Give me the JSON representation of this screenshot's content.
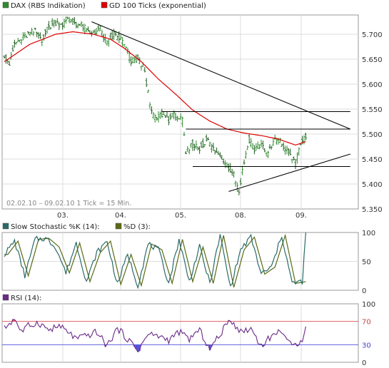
{
  "chart_data": [
    {
      "type": "line",
      "subtype": "ohlc-bars",
      "instrument": "DAX (RBS Indikation)",
      "series": [
        {
          "name": "DAX (RBS Indikation)",
          "color": "#2f8a2f"
        },
        {
          "name": "GD 100 Ticks (exponential)",
          "color": "#dd0000"
        }
      ],
      "info_text": "02.02.10 – 09.02.10   1 Tick = 15 Min.",
      "x_ticks": [
        "03.",
        "04.",
        "05.",
        "08.",
        "09."
      ],
      "y_ticks": [
        "5.700",
        "5.650",
        "5.600",
        "5.550",
        "5.500",
        "5.450",
        "5.400",
        "5.350"
      ],
      "ylim": [
        5350,
        5735
      ],
      "grid": true,
      "price_anchors": [
        [
          0,
          5660
        ],
        [
          3,
          5640
        ],
        [
          6,
          5680
        ],
        [
          10,
          5690
        ],
        [
          14,
          5700
        ],
        [
          18,
          5705
        ],
        [
          22,
          5690
        ],
        [
          26,
          5715
        ],
        [
          30,
          5725
        ],
        [
          34,
          5720
        ],
        [
          38,
          5730
        ],
        [
          42,
          5722
        ],
        [
          46,
          5715
        ],
        [
          50,
          5700
        ],
        [
          52,
          5705
        ],
        [
          56,
          5710
        ],
        [
          60,
          5680
        ],
        [
          64,
          5700
        ],
        [
          68,
          5690
        ],
        [
          72,
          5665
        ],
        [
          74,
          5645
        ],
        [
          78,
          5650
        ],
        [
          82,
          5630
        ],
        [
          85,
          5555
        ],
        [
          88,
          5530
        ],
        [
          92,
          5540
        ],
        [
          96,
          5530
        ],
        [
          100,
          5540
        ],
        [
          104,
          5525
        ],
        [
          106,
          5460
        ],
        [
          110,
          5480
        ],
        [
          114,
          5470
        ],
        [
          118,
          5490
        ],
        [
          122,
          5470
        ],
        [
          126,
          5455
        ],
        [
          130,
          5440
        ],
        [
          134,
          5420
        ],
        [
          137,
          5385
        ],
        [
          140,
          5445
        ],
        [
          143,
          5490
        ],
        [
          146,
          5470
        ],
        [
          150,
          5480
        ],
        [
          154,
          5460
        ],
        [
          158,
          5490
        ],
        [
          161,
          5485
        ],
        [
          164,
          5470
        ],
        [
          167,
          5460
        ],
        [
          170,
          5440
        ],
        [
          173,
          5480
        ],
        [
          176,
          5495
        ]
      ],
      "ema_anchors": [
        [
          0,
          5645
        ],
        [
          15,
          5680
        ],
        [
          30,
          5700
        ],
        [
          40,
          5705
        ],
        [
          52,
          5700
        ],
        [
          62,
          5690
        ],
        [
          70,
          5672
        ],
        [
          80,
          5645
        ],
        [
          90,
          5610
        ],
        [
          100,
          5580
        ],
        [
          110,
          5548
        ],
        [
          120,
          5526
        ],
        [
          130,
          5510
        ],
        [
          140,
          5502
        ],
        [
          150,
          5497
        ],
        [
          160,
          5490
        ],
        [
          170,
          5478
        ],
        [
          176,
          5485
        ]
      ],
      "trendlines": [
        {
          "name": "resistance",
          "from": [
            51,
            5725
          ],
          "to": [
            202,
            5510
          ]
        },
        {
          "name": "support",
          "from": [
            131,
            5385
          ],
          "to": [
            202,
            5460
          ]
        },
        {
          "name": "channel-top",
          "from": [
            92,
            5545
          ],
          "to": [
            202,
            5545
          ]
        },
        {
          "name": "range-top",
          "from": [
            106,
            5510
          ],
          "to": [
            202,
            5510
          ]
        },
        {
          "name": "range-bottom",
          "from": [
            110,
            5435
          ],
          "to": [
            202,
            5435
          ]
        }
      ],
      "n_ticks": 202
    },
    {
      "type": "line",
      "series": [
        {
          "name": "Slow Stochastic %K (14):",
          "color": "#2a6a68"
        },
        {
          "name": "%D (3):",
          "color": "#5a6a14"
        }
      ],
      "y_ticks": [
        "100",
        "50",
        "0"
      ],
      "ylim": [
        0,
        100
      ],
      "stoch_anchors": [
        [
          0,
          62
        ],
        [
          6,
          85
        ],
        [
          12,
          25
        ],
        [
          18,
          88
        ],
        [
          24,
          90
        ],
        [
          30,
          75
        ],
        [
          36,
          30
        ],
        [
          42,
          82
        ],
        [
          48,
          15
        ],
        [
          54,
          65
        ],
        [
          60,
          85
        ],
        [
          66,
          10
        ],
        [
          72,
          62
        ],
        [
          78,
          8
        ],
        [
          84,
          80
        ],
        [
          90,
          70
        ],
        [
          96,
          12
        ],
        [
          102,
          88
        ],
        [
          108,
          15
        ],
        [
          114,
          75
        ],
        [
          120,
          12
        ],
        [
          126,
          95
        ],
        [
          132,
          5
        ],
        [
          138,
          70
        ],
        [
          144,
          92
        ],
        [
          150,
          28
        ],
        [
          156,
          40
        ],
        [
          162,
          95
        ],
        [
          168,
          12
        ],
        [
          174,
          15
        ],
        [
          176,
          98
        ]
      ]
    },
    {
      "type": "line",
      "series": [
        {
          "name": "RSI (14):",
          "color": "#6a2a88"
        }
      ],
      "y_ticks": [
        "100",
        "70",
        "30",
        "0"
      ],
      "ylim": [
        0,
        100
      ],
      "reference_lines": [
        70,
        30
      ],
      "rsi_anchors": [
        [
          0,
          58
        ],
        [
          6,
          75
        ],
        [
          10,
          52
        ],
        [
          14,
          62
        ],
        [
          20,
          68
        ],
        [
          26,
          55
        ],
        [
          32,
          62
        ],
        [
          38,
          50
        ],
        [
          42,
          40
        ],
        [
          48,
          45
        ],
        [
          54,
          52
        ],
        [
          60,
          28
        ],
        [
          66,
          58
        ],
        [
          72,
          40
        ],
        [
          78,
          20
        ],
        [
          84,
          48
        ],
        [
          90,
          45
        ],
        [
          96,
          38
        ],
        [
          102,
          52
        ],
        [
          108,
          40
        ],
        [
          114,
          55
        ],
        [
          120,
          22
        ],
        [
          126,
          48
        ],
        [
          132,
          74
        ],
        [
          138,
          52
        ],
        [
          144,
          58
        ],
        [
          150,
          28
        ],
        [
          156,
          45
        ],
        [
          162,
          55
        ],
        [
          168,
          25
        ],
        [
          174,
          40
        ],
        [
          176,
          65
        ]
      ]
    }
  ]
}
